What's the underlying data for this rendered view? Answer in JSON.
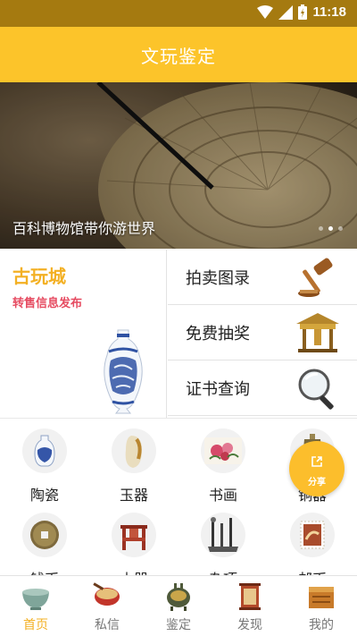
{
  "status_bar": {
    "time": "11:18"
  },
  "header": {
    "title": "文玩鉴定"
  },
  "banner": {
    "caption": "百科博物馆带你游世界",
    "slides": 3,
    "active_slide": 1
  },
  "promo": {
    "left": {
      "title": "古玩城",
      "subtitle": "转售信息发布",
      "image_icon": "blue-white-vase"
    },
    "right": [
      {
        "label": "拍卖图录",
        "icon": "gavel-icon"
      },
      {
        "label": "免费抽奖",
        "icon": "pavilion-icon"
      },
      {
        "label": "证书查询",
        "icon": "magnifier-icon"
      }
    ]
  },
  "categories": [
    {
      "label": "陶瓷",
      "icon": "porcelain-vase-icon"
    },
    {
      "label": "玉器",
      "icon": "jade-icon"
    },
    {
      "label": "书画",
      "icon": "peony-painting-icon"
    },
    {
      "label": "铜器",
      "icon": "bronze-icon"
    },
    {
      "label": "钱币",
      "icon": "coin-icon"
    },
    {
      "label": "木器",
      "icon": "wooden-chair-icon"
    },
    {
      "label": "杂项",
      "icon": "misc-tools-icon"
    },
    {
      "label": "邮币",
      "icon": "stamp-icon"
    }
  ],
  "share_button": {
    "label": "分享",
    "icon": "share-icon"
  },
  "tabbar": {
    "active_index": 0,
    "tabs": [
      {
        "label": "首页",
        "icon": "bowl-icon"
      },
      {
        "label": "私信",
        "icon": "drum-icon"
      },
      {
        "label": "鉴定",
        "icon": "ding-vessel-icon"
      },
      {
        "label": "发现",
        "icon": "lantern-icon"
      },
      {
        "label": "我的",
        "icon": "treasure-box-icon"
      }
    ]
  },
  "colors": {
    "header": "#fcc42a",
    "status_bar": "#a57a10",
    "accent": "#f3b023",
    "subtitle": "#e64b61"
  }
}
